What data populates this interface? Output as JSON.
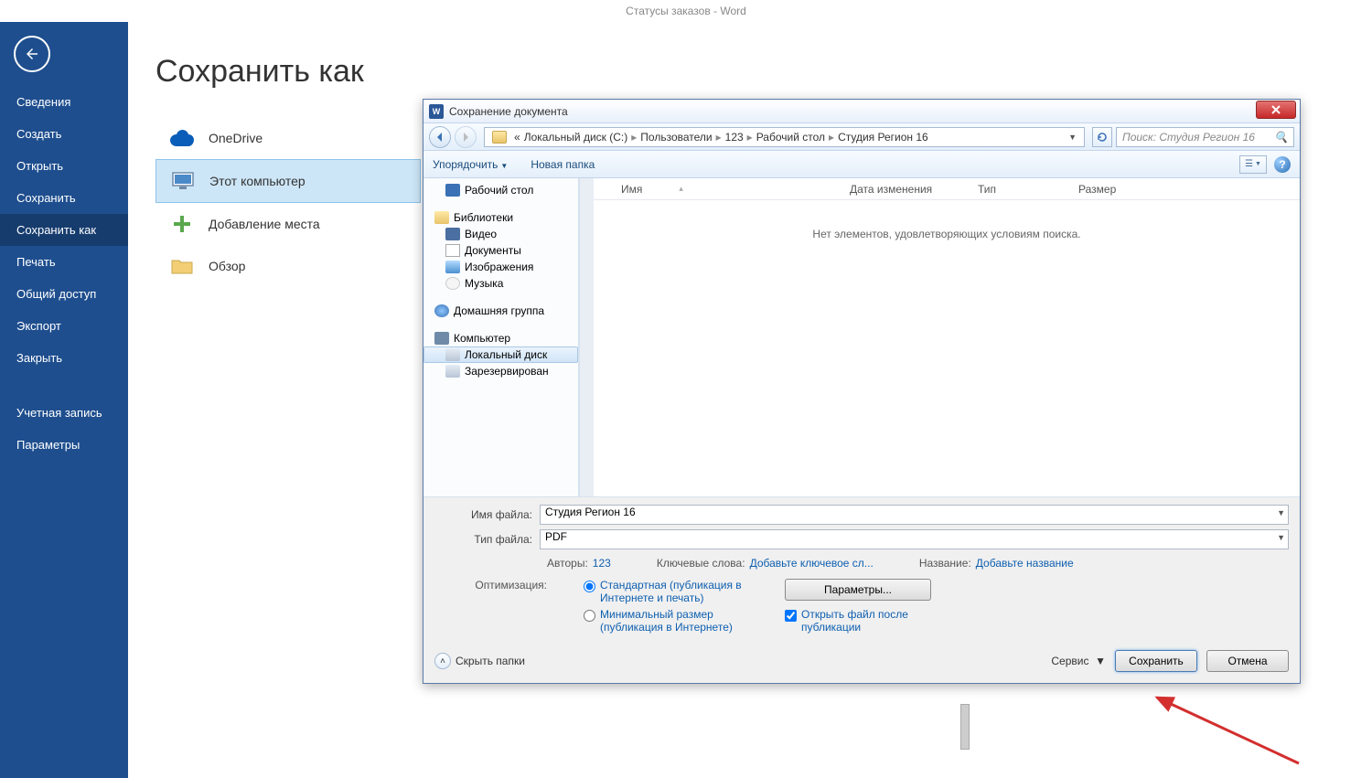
{
  "app_title": "Статусы заказов - Word",
  "sidebar": {
    "items": [
      {
        "label": "Сведения"
      },
      {
        "label": "Создать"
      },
      {
        "label": "Открыть"
      },
      {
        "label": "Сохранить"
      },
      {
        "label": "Сохранить как",
        "active": true
      },
      {
        "label": "Печать"
      },
      {
        "label": "Общий доступ"
      },
      {
        "label": "Экспорт"
      },
      {
        "label": "Закрыть"
      }
    ],
    "extra": [
      {
        "label": "Учетная запись"
      },
      {
        "label": "Параметры"
      }
    ]
  },
  "page_title": "Сохранить как",
  "places": [
    {
      "label": "OneDrive"
    },
    {
      "label": "Этот компьютер",
      "active": true
    },
    {
      "label": "Добавление места"
    },
    {
      "label": "Обзор"
    }
  ],
  "dialog": {
    "title": "Сохранение документа",
    "breadcrumb": {
      "prefix": "«",
      "parts": [
        "Локальный диск (C:)",
        "Пользователи",
        "123",
        "Рабочий стол",
        "Студия Регион 16"
      ]
    },
    "search_placeholder": "Поиск: Студия Регион 16",
    "toolbar": {
      "organize": "Упорядочить",
      "new_folder": "Новая папка"
    },
    "tree": [
      {
        "label": "Рабочий стол",
        "icon": "desktop",
        "indent": 1
      },
      {
        "label": "",
        "spacer": true
      },
      {
        "label": "Библиотеки",
        "icon": "lib",
        "indent": 0
      },
      {
        "label": "Видео",
        "icon": "vid",
        "indent": 1
      },
      {
        "label": "Документы",
        "icon": "doc",
        "indent": 1
      },
      {
        "label": "Изображения",
        "icon": "img",
        "indent": 1
      },
      {
        "label": "Музыка",
        "icon": "mus",
        "indent": 1
      },
      {
        "label": "",
        "spacer": true
      },
      {
        "label": "Домашняя группа",
        "icon": "home",
        "indent": 0
      },
      {
        "label": "",
        "spacer": true
      },
      {
        "label": "Компьютер",
        "icon": "comp",
        "indent": 0
      },
      {
        "label": "Локальный диск",
        "icon": "disk",
        "indent": 1,
        "selected": true
      },
      {
        "label": "Зарезервирован",
        "icon": "disk",
        "indent": 1
      }
    ],
    "columns": {
      "name": "Имя",
      "date": "Дата изменения",
      "type": "Тип",
      "size": "Размер"
    },
    "empty_message": "Нет элементов, удовлетворяющих условиям поиска.",
    "filename_label": "Имя файла:",
    "filename_value": "Студия Регион 16",
    "filetype_label": "Тип файла:",
    "filetype_value": "PDF",
    "meta": {
      "authors_label": "Авторы:",
      "authors_value": "123",
      "keywords_label": "Ключевые слова:",
      "keywords_value": "Добавьте ключевое сл...",
      "title_label": "Название:",
      "title_value": "Добавьте название"
    },
    "optimization_label": "Оптимизация:",
    "opt_standard": "Стандартная (публикация в Интернете и печать)",
    "opt_min": "Минимальный размер (публикация в Интернете)",
    "params_button": "Параметры...",
    "open_after": "Открыть файл после публикации",
    "hide_folders": "Скрыть папки",
    "service": "Сервис",
    "save": "Сохранить",
    "cancel": "Отмена"
  }
}
